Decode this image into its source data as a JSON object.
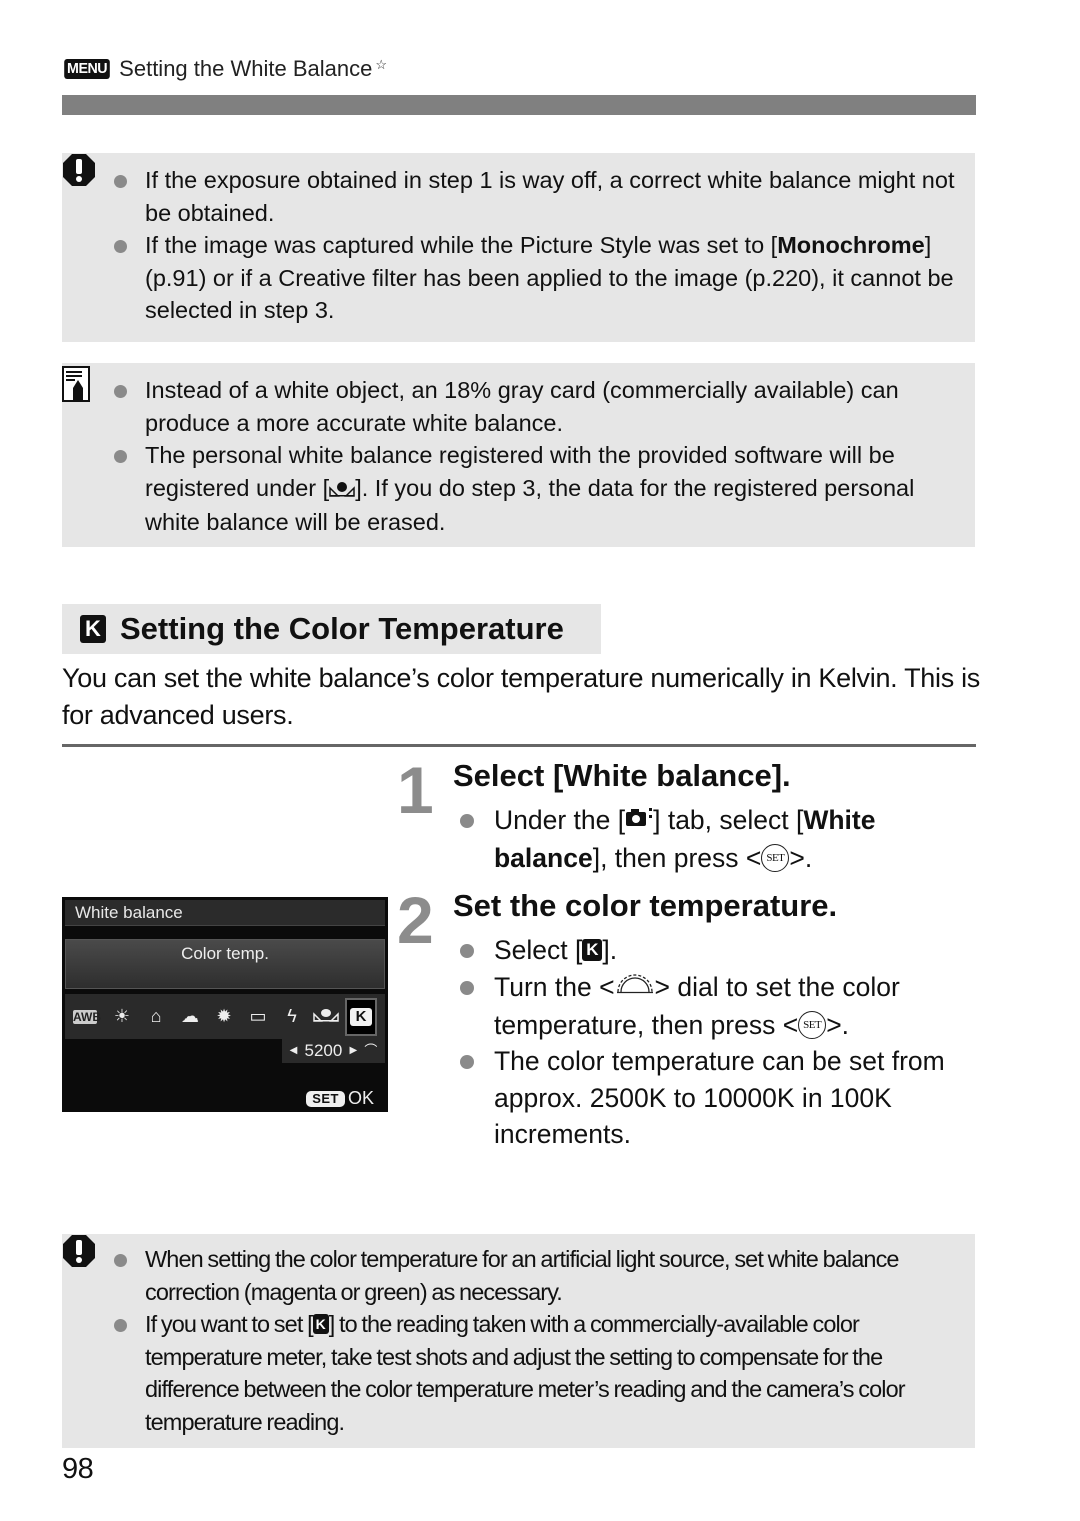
{
  "header": {
    "menu_badge": "MENU",
    "title": "Setting the White Balance",
    "star": "☆"
  },
  "caution_box_1": {
    "icon": "caution-icon",
    "items": [
      {
        "text": "If the exposure obtained in step 1 is way off, a correct white balance might not be obtained."
      },
      {
        "pre": "If the image was captured while the Picture Style was set to [",
        "bold": "Monochrome",
        "post": "] (p.91) or if a Creative filter has been applied to the image (p.220), it cannot be selected in step 3."
      }
    ]
  },
  "note_box": {
    "icon": "note-pencil-icon",
    "items": [
      {
        "text": "Instead of a white object, an 18% gray card (commercially available) can produce a more accurate white balance."
      },
      {
        "pre": "The personal white balance registered with the provided software will be registered under [",
        "icon": "personal-wb-icon",
        "post": "]. If you do step 3, the data for the registered personal white balance will be erased."
      }
    ]
  },
  "section": {
    "icon_letter": "K",
    "title": "Setting the Color Temperature",
    "intro": "You can set the white balance’s color temperature numerically in Kelvin. This is for advanced users."
  },
  "steps": [
    {
      "number": "1",
      "title": "Select [White balance].",
      "bullets": [
        {
          "pre": "Under the [",
          "icon": "shooting-tab-icon",
          "mid": "] tab, select [",
          "bold": "White balance",
          "post": "], then press <",
          "button": "SET",
          "end": ">."
        }
      ]
    },
    {
      "number": "2",
      "title": "Set the color temperature.",
      "bullets": [
        {
          "pre": "Select [",
          "k": "K",
          "post": "]."
        },
        {
          "pre": "Turn the <",
          "icon": "main-dial-icon",
          "mid": "> dial to set the color temperature, then press <",
          "button": "SET",
          "post": ">."
        },
        {
          "text": "The color temperature can be set from approx. 2500K to 10000K in 100K increments."
        }
      ]
    }
  ],
  "camera_screen": {
    "title": "White balance",
    "mode": "Color temp.",
    "icons": [
      "AWB",
      "daylight",
      "shade",
      "cloudy",
      "tungsten",
      "white-fluorescent",
      "flash",
      "custom",
      "K"
    ],
    "selected": "K",
    "value": "5200",
    "ok_button": "SET",
    "ok_label": "OK"
  },
  "caution_box_2": {
    "icon": "caution-icon",
    "items": [
      {
        "text": "When setting the color temperature for an artificial light source, set white balance correction (magenta or green) as necessary."
      },
      {
        "pre": "If you want to set [",
        "k": "K",
        "post": "] to the reading taken with a commercially-available color temperature meter, take test shots and adjust the setting to compensate for the difference between the color temperature meter’s reading and the camera’s color temperature reading."
      }
    ]
  },
  "page_number": "98"
}
